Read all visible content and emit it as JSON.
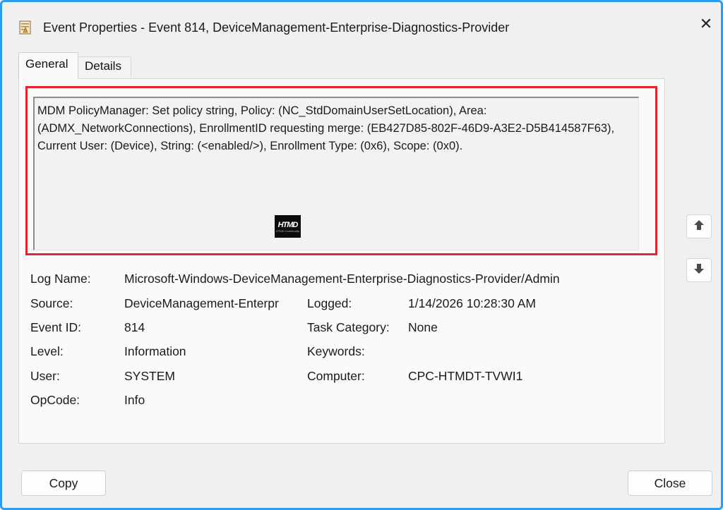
{
  "window": {
    "title": "Event Properties - Event 814, DeviceManagement-Enterprise-Diagnostics-Provider",
    "icon": "event-log-icon",
    "close_glyph": "✕",
    "border_color": "#2d9bf0"
  },
  "tabs": [
    {
      "label": "General",
      "selected": true
    },
    {
      "label": "Details",
      "selected": false
    }
  ],
  "message": {
    "text": "MDM PolicyManager: Set policy string, Policy: (NC_StdDomainUserSetLocation), Area: (ADMX_NetworkConnections), EnrollmentID requesting merge: (EB427D85-802F-46D9-A3E2-D5B414587F63), Current User: (Device), String: (<enabled/>), Enrollment Type: (0x6), Scope: (0x0).",
    "highlight_color": "#e0262f"
  },
  "watermark": {
    "logo_text": "HTMD",
    "small_text": "HTMD Community"
  },
  "properties": {
    "log_name_label": "Log Name:",
    "log_name_value": "Microsoft-Windows-DeviceManagement-Enterprise-Diagnostics-Provider/Admin",
    "source_label": "Source:",
    "source_value": "DeviceManagement-Enterpr",
    "logged_label": "Logged:",
    "logged_value": "1/14/2026 10:28:30 AM",
    "event_id_label": "Event ID:",
    "event_id_value": "814",
    "task_category_label": "Task Category:",
    "task_category_value": "None",
    "level_label": "Level:",
    "level_value": "Information",
    "keywords_label": "Keywords:",
    "keywords_value": "",
    "user_label": "User:",
    "user_value": "SYSTEM",
    "computer_label": "Computer:",
    "computer_value": "CPC-HTMDT-TVWI1",
    "opcode_label": "OpCode:",
    "opcode_value": "Info"
  },
  "buttons": {
    "copy_label": "Copy",
    "close_label": "Close"
  }
}
